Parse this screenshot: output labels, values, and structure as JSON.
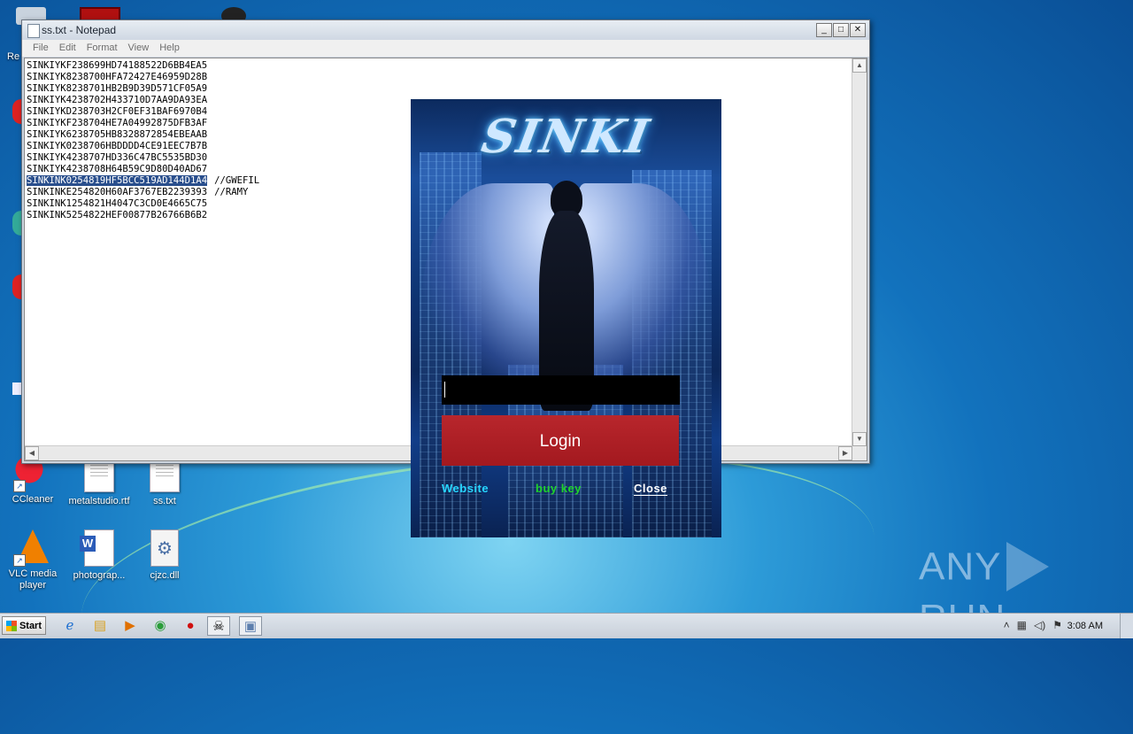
{
  "notepad": {
    "title": "ss.txt - Notepad",
    "menu": [
      "File",
      "Edit",
      "Format",
      "View",
      "Help"
    ],
    "controls": {
      "minimize": "_",
      "maximize": "□",
      "close": "✕"
    },
    "lines": [
      {
        "text": "SINKIYKF238699HD74188522D6BB4EA5",
        "comment": "",
        "selected": false
      },
      {
        "text": "SINKIYK8238700HFA72427E46959D28B",
        "comment": "",
        "selected": false
      },
      {
        "text": "SINKIYK8238701HB2B9D39D571CF05A9",
        "comment": "",
        "selected": false
      },
      {
        "text": "SINKIYK4238702H433710D7AA9DA93EA",
        "comment": "",
        "selected": false
      },
      {
        "text": "SINKIYKD238703H2CF0EF31BAF6970B4",
        "comment": "",
        "selected": false
      },
      {
        "text": "SINKIYKF238704HE7A04992875DFB3AF",
        "comment": "",
        "selected": false
      },
      {
        "text": "SINKIYK6238705HB8328872854EBEAAB",
        "comment": "",
        "selected": false
      },
      {
        "text": "SINKIYK0238706HBDDDD4CE91EEC7B7B",
        "comment": "",
        "selected": false
      },
      {
        "text": "SINKIYK4238707HD336C47BC5535BD30",
        "comment": "",
        "selected": false
      },
      {
        "text": "SINKIYK4238708H64B59C9D80D40AD67",
        "comment": "",
        "selected": false
      },
      {
        "text": "SINKINK0254819HF5BCC519AD144D1A4",
        "comment": "//GWEFIL",
        "selected": true
      },
      {
        "text": "SINKINKE254820H60AF3767EB2239393",
        "comment": "//RAMY",
        "selected": false
      },
      {
        "text": "SINKINK1254821H4047C3CD0E4665C75",
        "comment": "",
        "selected": false
      },
      {
        "text": "SINKINK5254822HEF00877B26766B6B2",
        "comment": "",
        "selected": false
      }
    ]
  },
  "login": {
    "logo": "SINKI",
    "key_value": "",
    "login_label": "Login",
    "website_label": "Website",
    "buy_key_label": "buy key",
    "close_label": "Close",
    "colors": {
      "website": "#27d6ff",
      "buy_key": "#1fd32c",
      "login_button": "#a91e24"
    }
  },
  "desktop": {
    "icons": [
      {
        "id": "ccleaner",
        "label": "CCleaner"
      },
      {
        "id": "metalstudio",
        "label": "metalstudio.rtf"
      },
      {
        "id": "ss",
        "label": "ss.txt"
      },
      {
        "id": "vlc",
        "label": "VLC media player"
      },
      {
        "id": "photograph",
        "label": "photograp..."
      },
      {
        "id": "cjzc",
        "label": "cjzc.dll"
      }
    ],
    "partial_label": "Re",
    "watermark": {
      "left": "ANY",
      "right": "RUN"
    }
  },
  "taskbar": {
    "start_label": "Start",
    "items": [
      "ie-icon",
      "explorer-icon",
      "media-player-icon",
      "chrome-icon",
      "opera-icon",
      "sinki-app-icon",
      "notepad-icon"
    ],
    "tray": [
      "show-hidden-icon",
      "network-icon",
      "volume-icon",
      "flag-icon"
    ],
    "clock": "3:08 AM"
  }
}
